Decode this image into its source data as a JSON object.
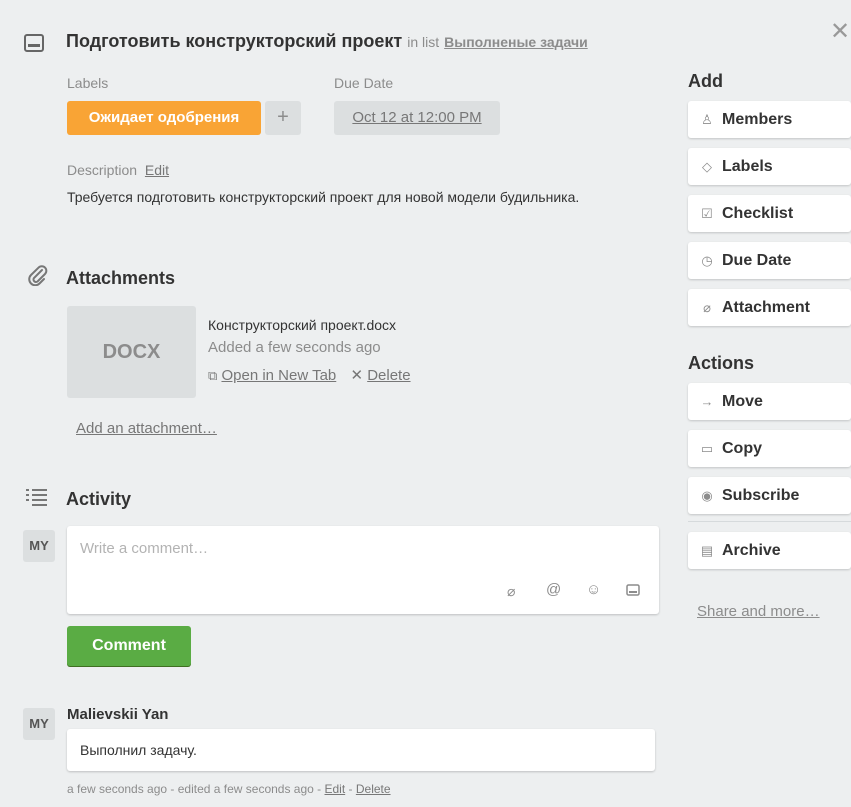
{
  "card": {
    "title": "Подготовить конструкторский проект",
    "in_list_text": "in list",
    "list_name": "Выполненые задачи"
  },
  "labels": {
    "heading": "Labels",
    "badge": "Ожидает одобрения",
    "badge_color": "#f9a435",
    "add_symbol": "+"
  },
  "due": {
    "heading": "Due Date",
    "value": "Oct 12 at 12:00 PM"
  },
  "description": {
    "heading": "Description",
    "edit_label": "Edit",
    "text": "Требуется подготовить конструкторский проект для новой модели будильника."
  },
  "attachments": {
    "heading": "Attachments",
    "item": {
      "thumb_label": "DOCX",
      "filename": "Конструкторский проект.docx",
      "added": "Added a few seconds ago",
      "open_label": "Open in New Tab",
      "delete_label": "Delete"
    },
    "add_label": "Add an attachment…"
  },
  "activity": {
    "heading": "Activity",
    "avatar_initials": "MY",
    "comment_placeholder": "Write a comment…",
    "comment_button": "Comment",
    "entries": [
      {
        "author": "Malievskii Yan",
        "initials": "MY",
        "text": "Выполнил задачу.",
        "meta_prefix": "a few seconds ago - edited a few seconds ago - ",
        "edit_label": "Edit",
        "sep": " - ",
        "delete_label": "Delete"
      }
    ]
  },
  "sidebar": {
    "add_heading": "Add",
    "add_items": [
      {
        "label": "Members",
        "icon": "person-icon"
      },
      {
        "label": "Labels",
        "icon": "tag-icon"
      },
      {
        "label": "Checklist",
        "icon": "checkbox-icon"
      },
      {
        "label": "Due Date",
        "icon": "clock-icon"
      },
      {
        "label": "Attachment",
        "icon": "paperclip-icon"
      }
    ],
    "actions_heading": "Actions",
    "action_items": [
      {
        "label": "Move",
        "icon": "arrow-right-icon"
      },
      {
        "label": "Copy",
        "icon": "copy-icon"
      },
      {
        "label": "Subscribe",
        "icon": "eye-icon"
      },
      {
        "label": "Archive",
        "icon": "archive-icon"
      }
    ],
    "share_label": "Share and more…"
  },
  "colors": {
    "background": "#edeff0",
    "comment_button": "#5aac44"
  }
}
